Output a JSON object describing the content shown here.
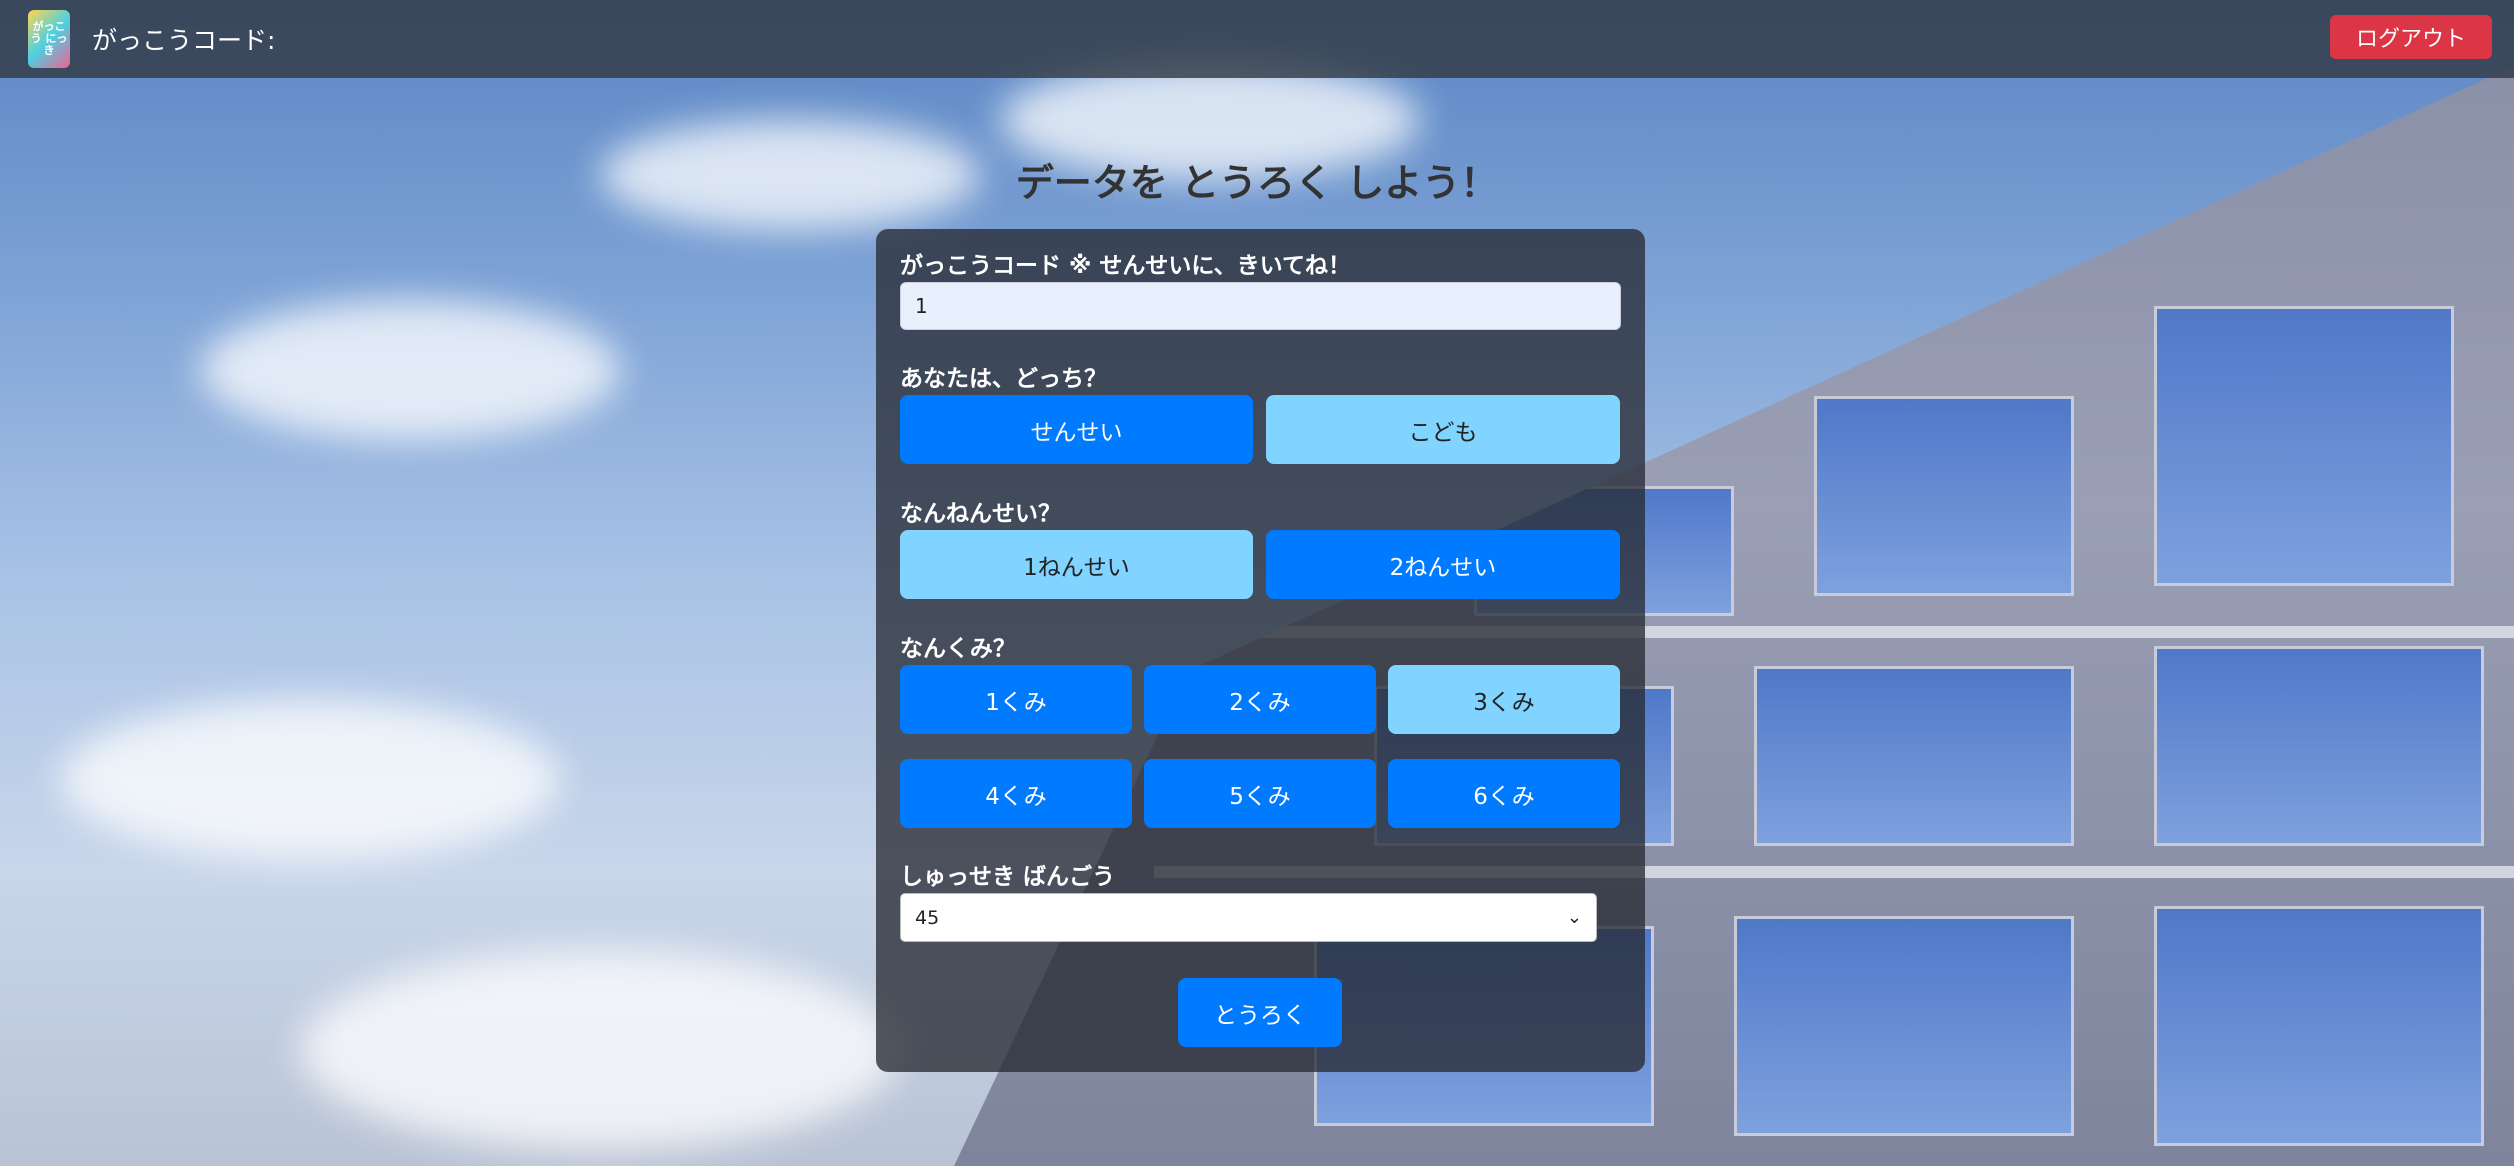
{
  "navbar": {
    "logo_text": "がっこう にっき",
    "title": "がっこうコード:",
    "logout_label": "ログアウト"
  },
  "page": {
    "heading": "データを とうろく しよう！"
  },
  "form": {
    "school_code": {
      "label": "がっこうコード ※ せんせいに、きいてね！",
      "value": "1"
    },
    "role": {
      "label": "あなたは、どっち？",
      "options": [
        {
          "label": "せんせい",
          "selected": true
        },
        {
          "label": "こども",
          "selected": false
        }
      ]
    },
    "grade": {
      "label": "なんねんせい？",
      "options": [
        {
          "label": "1ねんせい",
          "selected": false
        },
        {
          "label": "2ねんせい",
          "selected": true
        }
      ]
    },
    "class": {
      "label": "なんくみ？",
      "options": [
        {
          "label": "1くみ",
          "selected": true
        },
        {
          "label": "2くみ",
          "selected": true
        },
        {
          "label": "3くみ",
          "selected": false
        },
        {
          "label": "4くみ",
          "selected": true
        },
        {
          "label": "5くみ",
          "selected": true
        },
        {
          "label": "6くみ",
          "selected": true
        }
      ]
    },
    "student_number": {
      "label": "しゅっせき ばんごう",
      "selected": "45"
    },
    "submit_label": "とうろく"
  },
  "colors": {
    "active": "#007bff",
    "inactive": "#80d4ff",
    "logout": "#dc3545"
  }
}
